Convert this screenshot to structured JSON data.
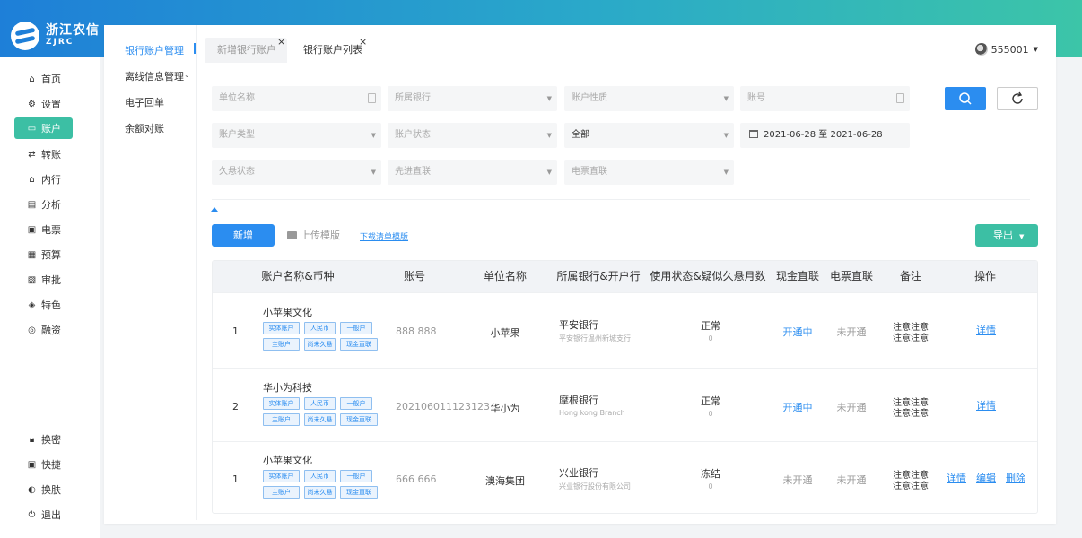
{
  "brand": {
    "cn": "浙江农信",
    "en": "ZJRC"
  },
  "nav": {
    "top": [
      {
        "label": "首页",
        "icon": "home-icon"
      },
      {
        "label": "设置",
        "icon": "gear-icon"
      },
      {
        "label": "账户",
        "icon": "account-icon",
        "active": true
      },
      {
        "label": "转账",
        "icon": "transfer-icon"
      },
      {
        "label": "内行",
        "icon": "bank-icon"
      },
      {
        "label": "分析",
        "icon": "chart-icon"
      },
      {
        "label": "电票",
        "icon": "ticket-icon"
      },
      {
        "label": "预算",
        "icon": "budget-icon"
      },
      {
        "label": "审批",
        "icon": "approval-icon"
      },
      {
        "label": "特色",
        "icon": "shield-icon"
      },
      {
        "label": "融资",
        "icon": "finance-icon"
      }
    ],
    "bottom": [
      {
        "label": "换密",
        "icon": "lock-icon"
      },
      {
        "label": "快捷",
        "icon": "shortcut-icon"
      },
      {
        "label": "换肤",
        "icon": "skin-icon"
      },
      {
        "label": "退出",
        "icon": "power-icon"
      }
    ]
  },
  "subnav": [
    "银行账户管理",
    "离线信息管理",
    "电子回单",
    "余额对账"
  ],
  "tabs": [
    {
      "label": "新增银行账户"
    },
    {
      "label": "银行账户列表"
    }
  ],
  "user": {
    "name": "555001"
  },
  "filters": {
    "unit_name": "单位名称",
    "bank": "所属银行",
    "acct_nature": "账户性质",
    "acct_no": "账号",
    "acct_type": "账户类型",
    "acct_status": "账户状态",
    "all": "全部",
    "date_range": "2021-06-28 至 2021-06-28",
    "dormant": "久悬状态",
    "direct": "先进直联",
    "eticket": "电票直联"
  },
  "toolbar": {
    "add": "新增",
    "upload": "上传模版",
    "download": "下载清单模版",
    "export": "导出"
  },
  "table": {
    "headers": [
      "账户名称&币种",
      "账号",
      "单位名称",
      "所属银行&开户行",
      "使用状态&疑似久悬月数",
      "现金直联",
      "电票直联",
      "备注",
      "操作"
    ],
    "rows": [
      {
        "idx": "1",
        "name": "小苹果文化",
        "tags": [
          "实体账户",
          "人民币",
          "一般户",
          "主账户",
          "尚未久悬",
          "现金直联"
        ],
        "acct": "888 888",
        "unit": "小苹果",
        "bank": "平安银行",
        "branch": "平安银行温州新城支行",
        "status": "正常",
        "months": "0",
        "cash": "开通中",
        "eticket": "未开通",
        "note1": "注意注意",
        "note2": "注意注意",
        "ops": [
          "详情"
        ]
      },
      {
        "idx": "2",
        "name": "华小为科技",
        "tags": [
          "实体账户",
          "人民币",
          "一般户",
          "主账户",
          "尚未久悬",
          "现金直联"
        ],
        "acct": "202106011123123",
        "unit": "华小为",
        "bank": "摩根银行",
        "branch": "Hong kong Branch",
        "status": "正常",
        "months": "0",
        "cash": "开通中",
        "eticket": "未开通",
        "note1": "注意注意",
        "note2": "注意注意",
        "ops": [
          "详情"
        ]
      },
      {
        "idx": "1",
        "name": "小苹果文化",
        "tags": [
          "实体账户",
          "人民币",
          "一般户",
          "主账户",
          "尚未久悬",
          "现金直联"
        ],
        "acct": "666 666",
        "unit": "澳海集团",
        "bank": "兴业银行",
        "branch": "兴业银行股份有限公司",
        "status": "冻结",
        "months": "0",
        "cash": "未开通",
        "eticket": "未开通",
        "note1": "注意注意",
        "note2": "注意注意",
        "ops": [
          "详情",
          "编辑",
          "删除"
        ]
      }
    ]
  },
  "colors": {
    "primary": "#2b8df0",
    "accent": "#3cbfa4"
  }
}
